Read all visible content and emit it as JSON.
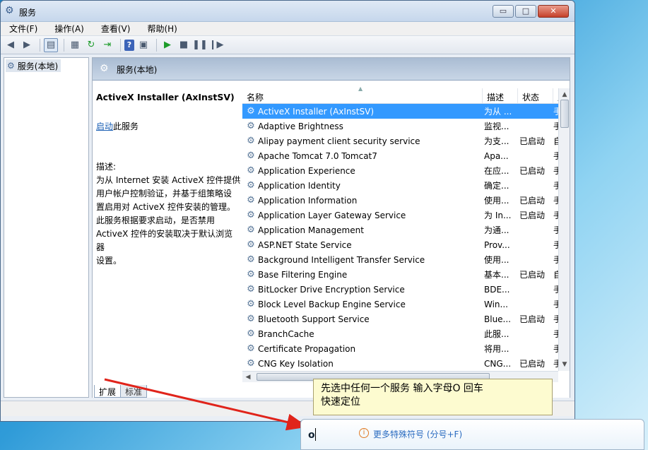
{
  "window": {
    "title": "服务",
    "controls": {
      "minimize": "▭",
      "maximize": "□",
      "close": "✕"
    }
  },
  "menu": [
    "文件(F)",
    "操作(A)",
    "查看(V)",
    "帮助(H)"
  ],
  "tree": {
    "item": "服务(本地)"
  },
  "panel": {
    "header": "服务(本地)"
  },
  "details": {
    "service_name": "ActiveX Installer (AxInstSV)",
    "start_link": "启动",
    "start_suffix": "此服务",
    "desc_label": "描述:",
    "desc_lines": [
      "为从 Internet 安装 ActiveX 控件提供",
      "用户帐户控制验证，并基于组策略设",
      "置启用对 ActiveX 控件安装的管理。",
      "此服务根据要求启动，是否禁用",
      "ActiveX 控件的安装取决于默认浏览器",
      "设置。"
    ]
  },
  "columns": {
    "name": "名称",
    "desc": "描述",
    "status": "状态",
    "start": "启"
  },
  "services": [
    {
      "name": "ActiveX Installer (AxInstSV)",
      "desc": "为从 ...",
      "status": "",
      "start": "手",
      "selected": true
    },
    {
      "name": "Adaptive Brightness",
      "desc": "监视...",
      "status": "",
      "start": "手"
    },
    {
      "name": "Alipay payment client security service",
      "desc": "为支...",
      "status": "已启动",
      "start": "自"
    },
    {
      "name": "Apache Tomcat 7.0 Tomcat7",
      "desc": "Apa...",
      "status": "",
      "start": "手"
    },
    {
      "name": "Application Experience",
      "desc": "在应...",
      "status": "已启动",
      "start": "手"
    },
    {
      "name": "Application Identity",
      "desc": "确定...",
      "status": "",
      "start": "手"
    },
    {
      "name": "Application Information",
      "desc": "使用...",
      "status": "已启动",
      "start": "手"
    },
    {
      "name": "Application Layer Gateway Service",
      "desc": "为 In...",
      "status": "已启动",
      "start": "手"
    },
    {
      "name": "Application Management",
      "desc": "为通...",
      "status": "",
      "start": "手"
    },
    {
      "name": "ASP.NET State Service",
      "desc": "Prov...",
      "status": "",
      "start": "手"
    },
    {
      "name": "Background Intelligent Transfer Service",
      "desc": "使用...",
      "status": "",
      "start": "手"
    },
    {
      "name": "Base Filtering Engine",
      "desc": "基本...",
      "status": "已启动",
      "start": "自"
    },
    {
      "name": "BitLocker Drive Encryption Service",
      "desc": "BDE...",
      "status": "",
      "start": "手"
    },
    {
      "name": "Block Level Backup Engine Service",
      "desc": "Win...",
      "status": "",
      "start": "手"
    },
    {
      "name": "Bluetooth Support Service",
      "desc": "Blue...",
      "status": "已启动",
      "start": "手"
    },
    {
      "name": "BranchCache",
      "desc": "此服...",
      "status": "",
      "start": "手"
    },
    {
      "name": "Certificate Propagation",
      "desc": "将用...",
      "status": "",
      "start": "手"
    },
    {
      "name": "CNG Key Isolation",
      "desc": "CNG...",
      "status": "已启动",
      "start": "手"
    }
  ],
  "tabs": [
    "扩展",
    "标准"
  ],
  "callout": {
    "line1": "先选中任何一个服务  输入字母O 回车",
    "line2": " 快速定位"
  },
  "ime": {
    "input": "o",
    "hint": "更多特殊符号 (分号+F)"
  },
  "colors": {
    "selection": "#3399ff",
    "arrow": "#e0241b",
    "callout_bg": "#fdfbd0"
  }
}
